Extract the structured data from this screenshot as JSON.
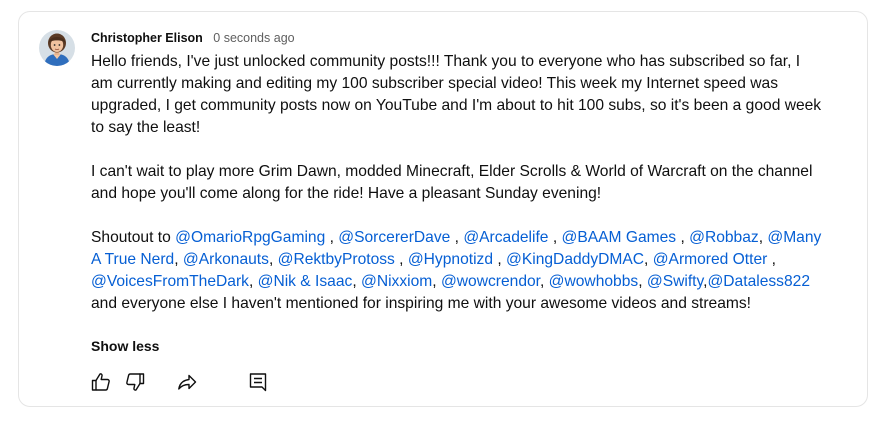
{
  "post": {
    "author": "Christopher Elison",
    "time": "0 seconds ago",
    "paragraph1": "Hello friends, I've just unlocked community posts!!! Thank you to everyone who has subscribed so far, I am currently making and editing my 100 subscriber special video! This week my Internet speed was upgraded, I get community posts now on YouTube and I'm about to hit 100 subs, so it's been a good week to say the least!",
    "paragraph2": "I can't wait to play more Grim Dawn, modded Minecraft, Elder Scrolls & World of Warcraft on the channel and hope you'll come along for the ride! Have a pleasant Sunday evening!",
    "shoutout_prefix": "Shoutout to ",
    "mentions": [
      {
        "text": "@OmarioRpgGaming",
        "after": " , "
      },
      {
        "text": "@SorcererDave",
        "after": " , "
      },
      {
        "text": "@Arcadelife",
        "after": " , "
      },
      {
        "text": "@BAAM Games",
        "after": " , "
      },
      {
        "text": "@Robbaz",
        "after": ", "
      },
      {
        "text": "@Many A True Nerd",
        "after": ", "
      },
      {
        "text": "@Arkonauts",
        "after": ", "
      },
      {
        "text": "@RektbyProtoss",
        "after": " , "
      },
      {
        "text": "@Hypnotizd",
        "after": " , "
      },
      {
        "text": "@KingDaddyDMAC",
        "after": ", "
      },
      {
        "text": "@Armored Otter",
        "after": " , "
      },
      {
        "text": "@VoicesFromTheDark",
        "after": ", "
      },
      {
        "text": "@Nik & Isaac",
        "after": ", "
      },
      {
        "text": "@Nixxiom",
        "after": ", "
      },
      {
        "text": "@wowcrendor",
        "after": ", "
      },
      {
        "text": "@wowhobbs",
        "after": ", "
      },
      {
        "text": "@Swifty",
        "after": ","
      },
      {
        "text": "@Dataless822",
        "after": ""
      }
    ],
    "shoutout_suffix": " and everyone else I haven't mentioned for inspiring me with your awesome videos and streams!",
    "show_less": "Show less"
  },
  "actions": [
    {
      "name": "like-button",
      "icon": "thumbs-up-icon"
    },
    {
      "name": "dislike-button",
      "icon": "thumbs-down-icon"
    },
    {
      "name": "share-button",
      "icon": "share-arrow-icon"
    },
    {
      "name": "comments-button",
      "icon": "comment-icon"
    }
  ],
  "colors": {
    "text": "#0f0f0f",
    "secondary_text": "#606060",
    "link": "#065fd4",
    "border": "#e5e5e5"
  }
}
